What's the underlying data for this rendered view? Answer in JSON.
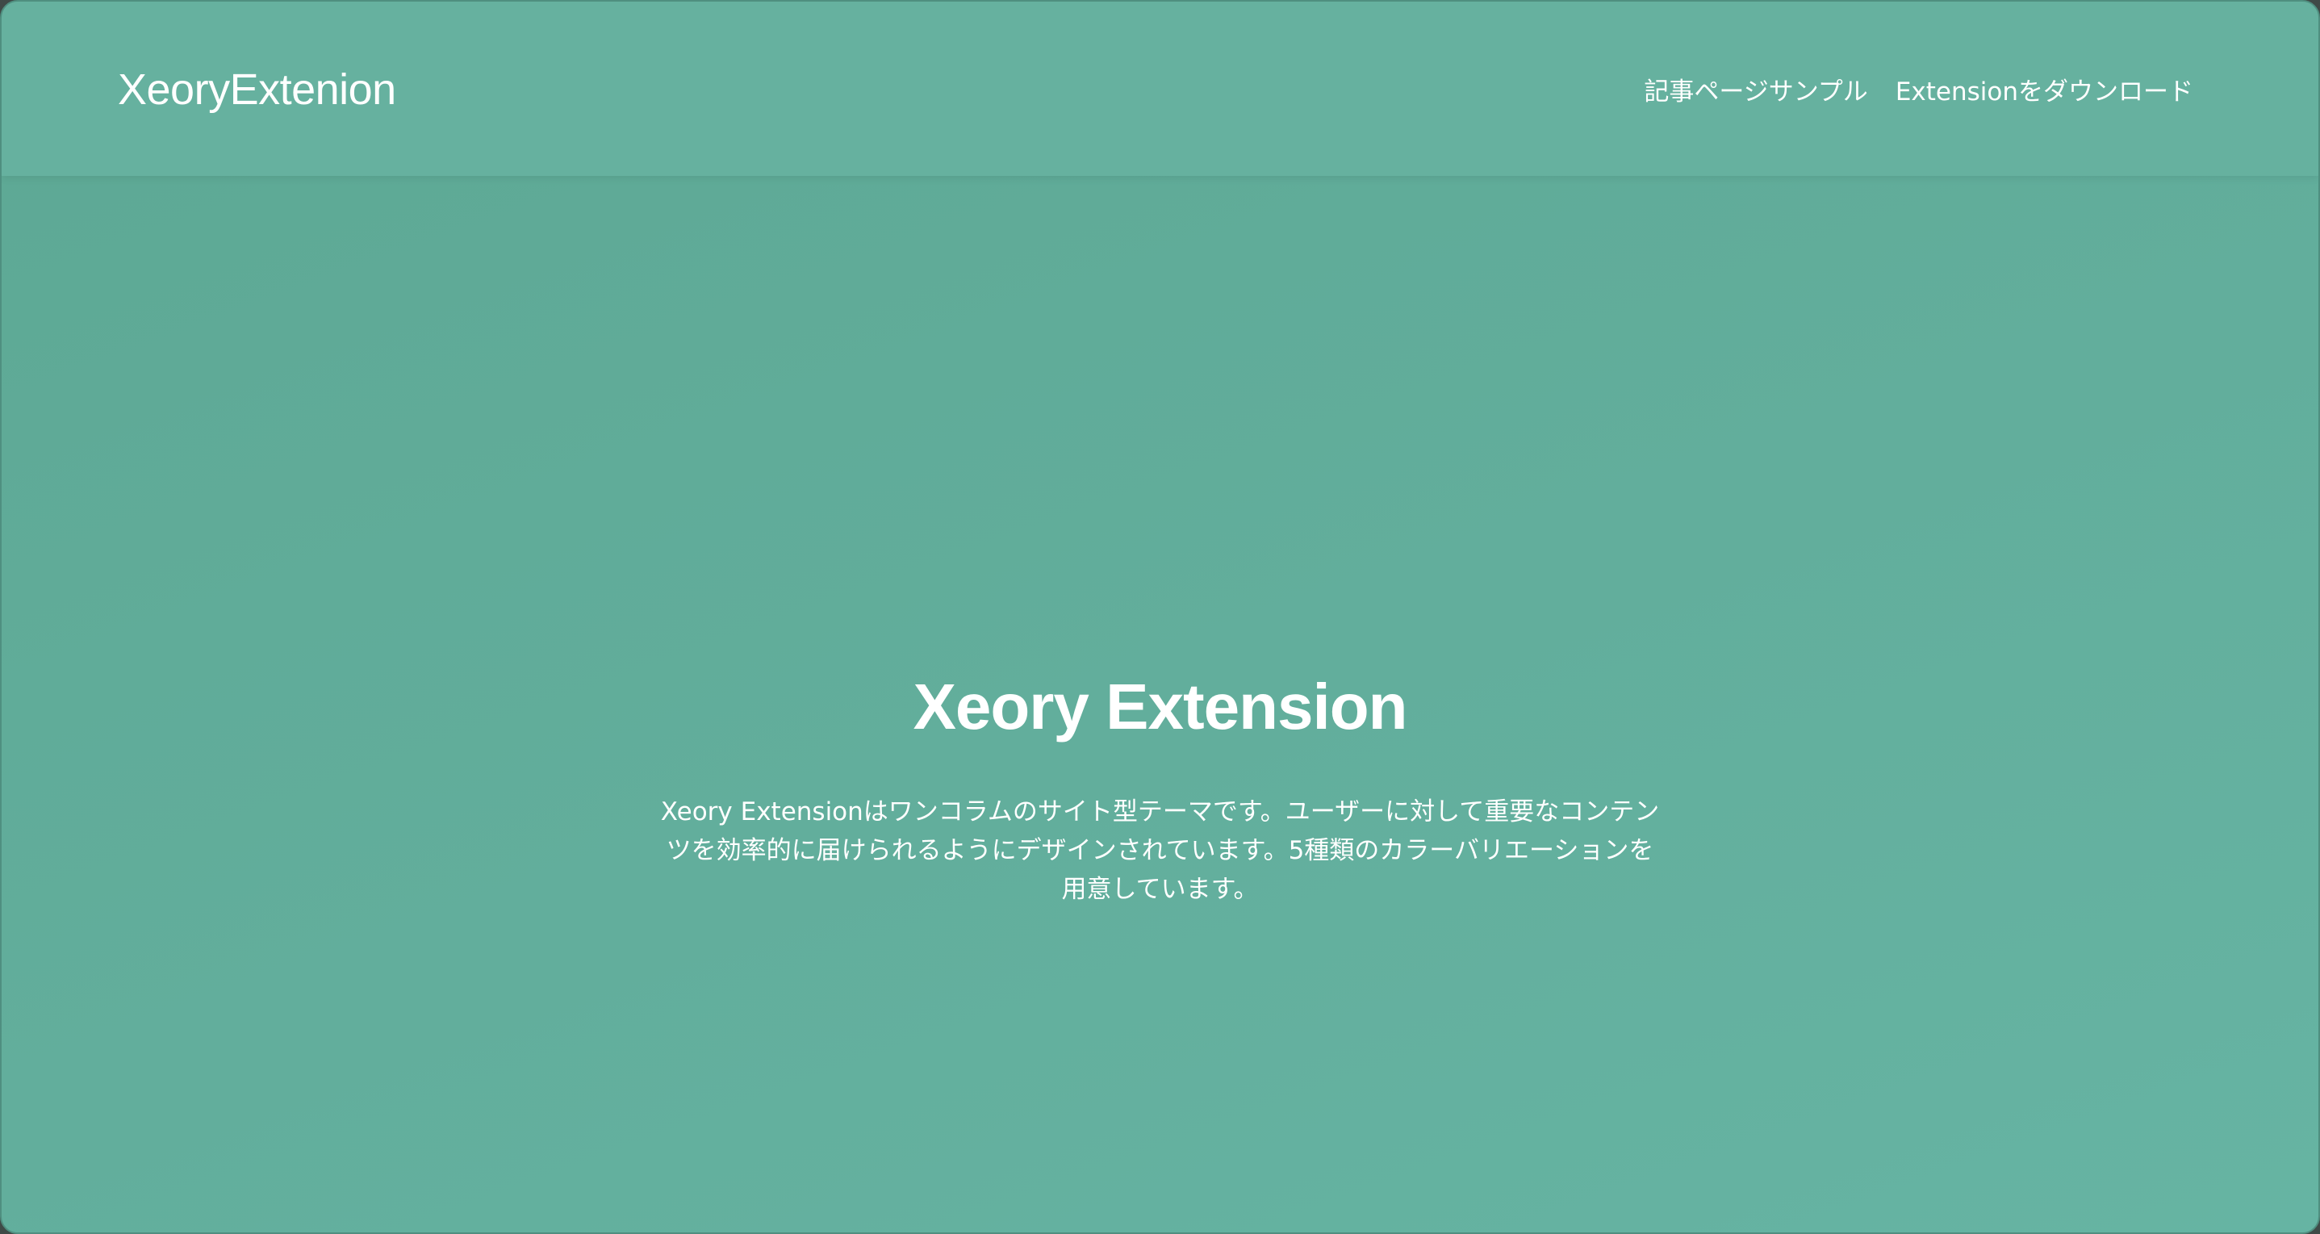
{
  "site": {
    "logo": "XeoryExtenion"
  },
  "nav": {
    "items": [
      {
        "label": "記事ページサンプル"
      },
      {
        "label": "Extensionをダウンロード"
      }
    ]
  },
  "hero": {
    "title": "Xeory Extension",
    "description": "Xeory Extensionはワンコラムのサイト型テーマです。ユーザーに対して重要なコンテンツを効率的に届けられるようにデザインされています。5種類のカラーバリエーションを用意しています。"
  },
  "colors": {
    "background": "#62ae9c",
    "header": "#66b19f",
    "text": "#ffffff"
  }
}
